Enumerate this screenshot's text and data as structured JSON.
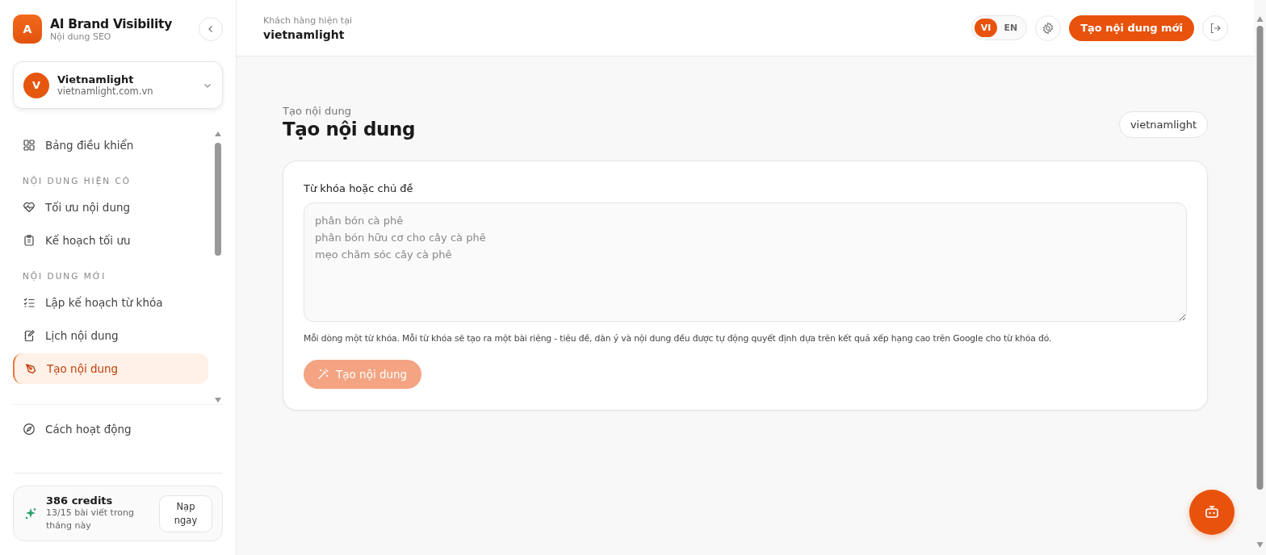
{
  "brand": {
    "logo_letter": "A",
    "name": "AI Brand Visibility",
    "subtitle": "Nội dung SEO"
  },
  "client_picker": {
    "avatar_letter": "V",
    "name": "Vietnamlight",
    "domain": "vietnamlight.com.vn"
  },
  "sidebar": {
    "top_items": [
      {
        "label": "Bảng điều khiển",
        "selected": false
      }
    ],
    "sections": [
      {
        "heading": "NỘI DUNG HIỆN CÓ",
        "items": [
          {
            "label": "Tối ưu nội dung",
            "selected": false
          },
          {
            "label": "Kế hoạch tối ưu",
            "selected": false
          }
        ]
      },
      {
        "heading": "NỘI DUNG MỚI",
        "items": [
          {
            "label": "Lập kế hoạch từ khóa",
            "selected": false
          },
          {
            "label": "Lịch nội dung",
            "selected": false
          },
          {
            "label": "Tạo nội dung",
            "selected": true
          }
        ]
      }
    ],
    "bottom_item": {
      "label": "Cách hoạt động"
    },
    "credits": {
      "amount": "386 credits",
      "usage": "13/15 bài viết trong tháng này",
      "button": "Nạp ngay"
    }
  },
  "topbar": {
    "client_label": "Khách hàng hiện tại",
    "client_name": "vietnamlight",
    "languages": [
      {
        "label": "VI",
        "selected": true
      },
      {
        "label": "EN",
        "selected": false
      }
    ],
    "new_button": "Tạo nội dung mới"
  },
  "page": {
    "breadcrumb": "Tạo nội dung",
    "title": "Tạo nội dung",
    "client_chip": "vietnamlight",
    "form": {
      "label": "Từ khóa hoặc chủ đề",
      "placeholder": "phân bón cà phê\nphân bón hữu cơ cho cây cà phê\nmẹo chăm sóc cây cà phê",
      "hint": "Mỗi dòng một từ khóa. Mỗi từ khóa sẽ tạo ra một bài riêng - tiêu đề, dàn ý và nội dung đều được tự động quyết định dựa trên kết quả xếp hạng cao trên Google cho từ khóa đó.",
      "submit": {
        "label": "Tạo nội dung",
        "disabled": true
      }
    }
  }
}
